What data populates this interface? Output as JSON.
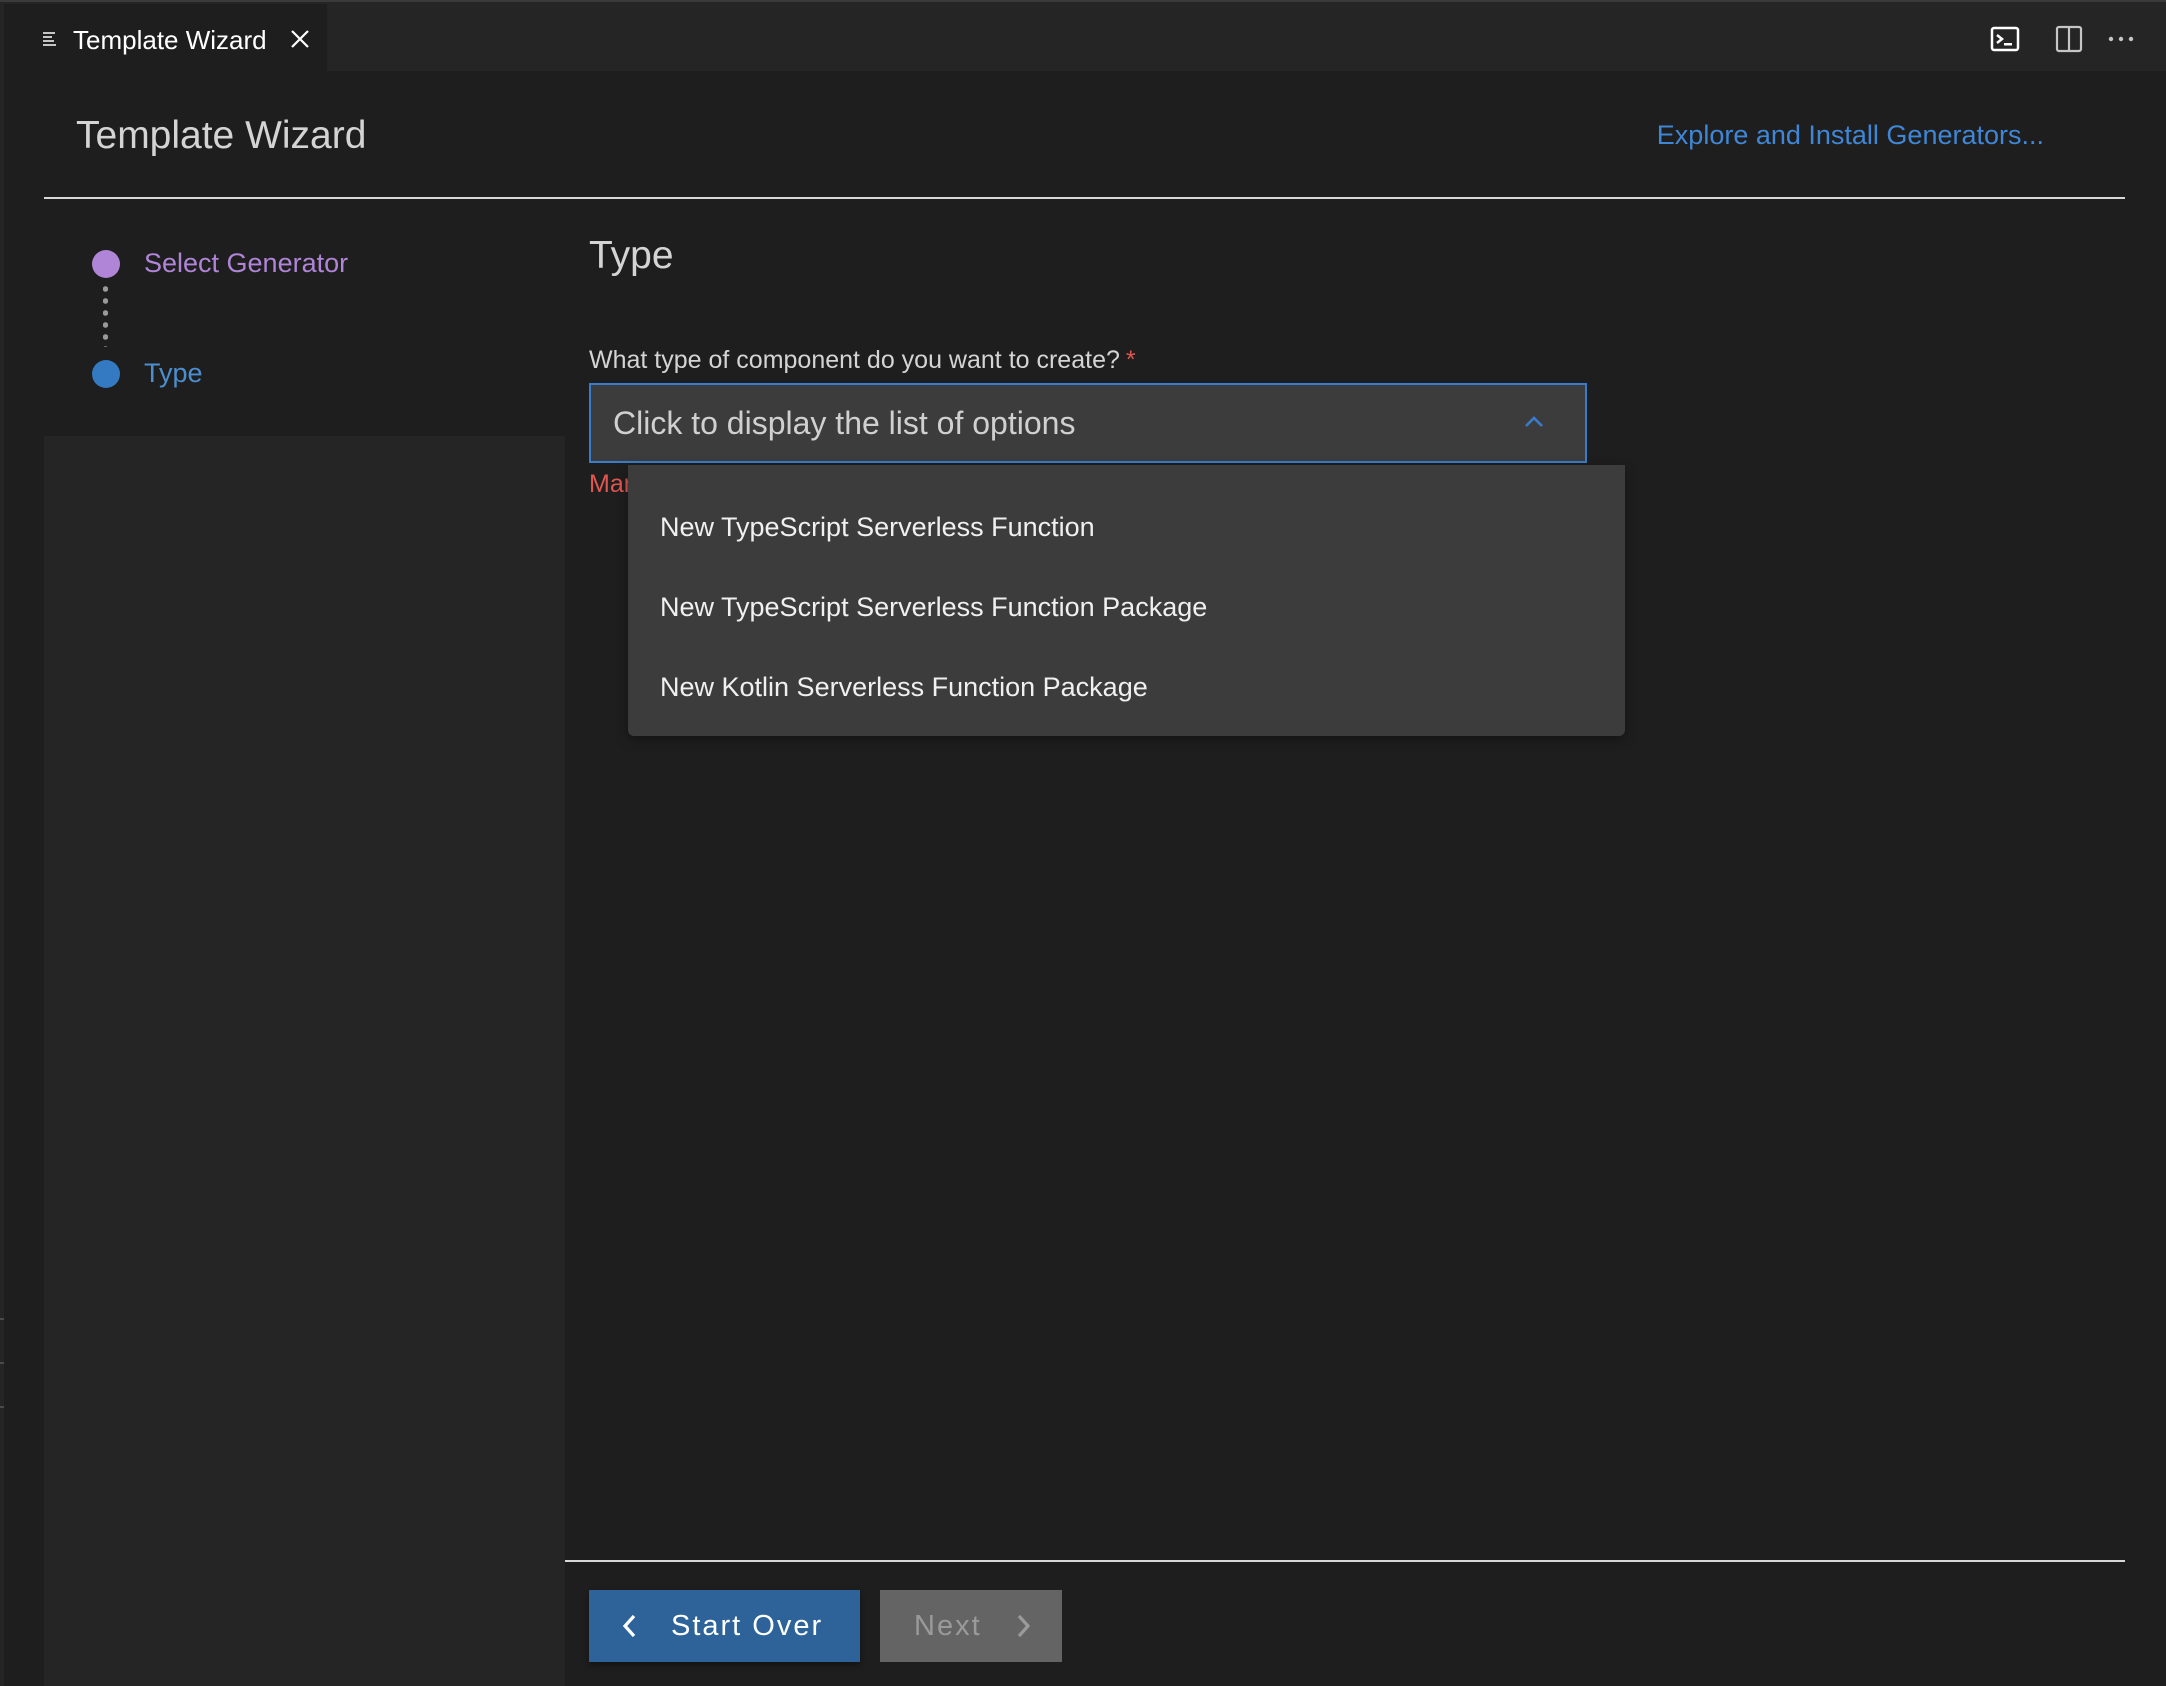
{
  "tab": {
    "title": "Template Wizard",
    "icon": "preview-lines-icon",
    "close_icon": "close-icon"
  },
  "tab_actions": [
    {
      "name": "terminal-icon",
      "label": "Open terminal"
    },
    {
      "name": "split-editor-icon",
      "label": "Split editor"
    },
    {
      "name": "more-actions-icon",
      "label": "More actions"
    }
  ],
  "header": {
    "title": "Template Wizard",
    "explore_link": "Explore and Install Generators..."
  },
  "stepper": {
    "steps": [
      {
        "label": "Select Generator",
        "state": "completed",
        "color": "#b085d8"
      },
      {
        "label": "Type",
        "state": "active",
        "color": "#347ac2"
      }
    ]
  },
  "form": {
    "section_title": "Type",
    "question": "What type of component do you want to create?",
    "required_marker": "*",
    "select": {
      "placeholder": "Click to display the list of options",
      "expanded": true,
      "options": [
        "New TypeScript Serverless Function",
        "New TypeScript Serverless Function Package",
        "New Kotlin Serverless Function Package"
      ]
    },
    "error": "Mandatory field"
  },
  "footer": {
    "back_button": "Start Over",
    "next_button": "Next",
    "next_enabled": false
  },
  "colors": {
    "accent": "#3a7ccc",
    "primary_button": "#2d6398",
    "error": "#e0574f",
    "completed_step": "#b085d8"
  }
}
